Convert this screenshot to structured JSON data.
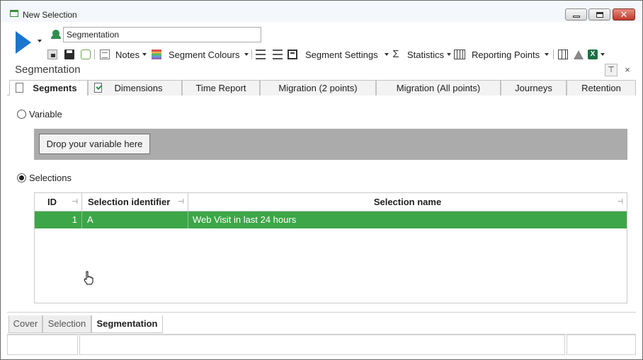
{
  "window": {
    "title": "New Selection"
  },
  "toolbar": {
    "selection_name_value": "Segmentation",
    "notes_label": "Notes",
    "segment_colours_label": "Segment Colours",
    "segment_settings_label": "Segment Settings",
    "statistics_label": "Statistics",
    "reporting_points_label": "Reporting Points",
    "excel_icon_text": "X"
  },
  "panel": {
    "title": "Segmentation",
    "pin_glyph": "⊤",
    "close_glyph": "×"
  },
  "tabs": [
    {
      "label": "Segments",
      "active": true
    },
    {
      "label": "Dimensions",
      "active": false
    },
    {
      "label": "Time Report",
      "active": false
    },
    {
      "label": "Migration (2 points)",
      "active": false
    },
    {
      "label": "Migration (All points)",
      "active": false
    },
    {
      "label": "Journeys",
      "active": false
    },
    {
      "label": "Retention",
      "active": false
    }
  ],
  "source": {
    "variable_label": "Variable",
    "drop_label": "Drop your variable here",
    "selections_label": "Selections",
    "selected_option": "Selections"
  },
  "grid": {
    "columns": [
      "ID",
      "Selection identifier",
      "Selection name"
    ],
    "rows": [
      {
        "id": "1",
        "identifier": "A",
        "name": "Web Visit in last 24 hours"
      }
    ],
    "selected_row_color": "#3da648"
  },
  "bottom_tabs": [
    {
      "label": "Cover",
      "active": false
    },
    {
      "label": "Selection",
      "active": false
    },
    {
      "label": "Segmentation",
      "active": true
    }
  ],
  "colors": {
    "accent_blue": "#1a75cf",
    "selection_green": "#3da648",
    "drop_zone_gray": "#ababab"
  }
}
